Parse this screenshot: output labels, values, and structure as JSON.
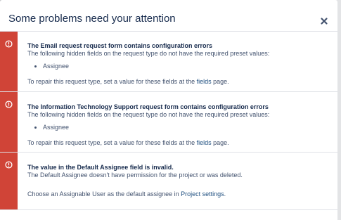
{
  "dialog": {
    "title": "Some problems need your attention",
    "close_label": "×"
  },
  "errors": [
    {
      "heading": "The Email request request form contains configuration errors",
      "description": "The following hidden fields on the request type do not have the required preset values:",
      "fields": [
        "Assignee"
      ],
      "repair_prefix": "To repair this request type, set a value for these fields at the ",
      "repair_link": "fields",
      "repair_suffix": " page."
    },
    {
      "heading": "The Information Technology Support request form contains configuration errors",
      "description": "The following hidden fields on the request type do not have the required preset values:",
      "fields": [
        "Assignee"
      ],
      "repair_prefix": "To repair this request type, set a value for these fields at the ",
      "repair_link": "fields",
      "repair_suffix": " page."
    },
    {
      "heading": "The value in the Default Assignee field is invalid.",
      "description": "The Default Assignee doesn't have permission for the project or was deleted.",
      "action_prefix": "Choose an Assignable User as the default assignee in ",
      "action_link": "Project settings",
      "action_suffix": "."
    }
  ],
  "colors": {
    "error_bar": "#d04437",
    "link": "#205081",
    "heading": "#172b4d",
    "body_text": "#42526e"
  },
  "icons": {
    "close": "close-icon",
    "error": "error-icon"
  }
}
